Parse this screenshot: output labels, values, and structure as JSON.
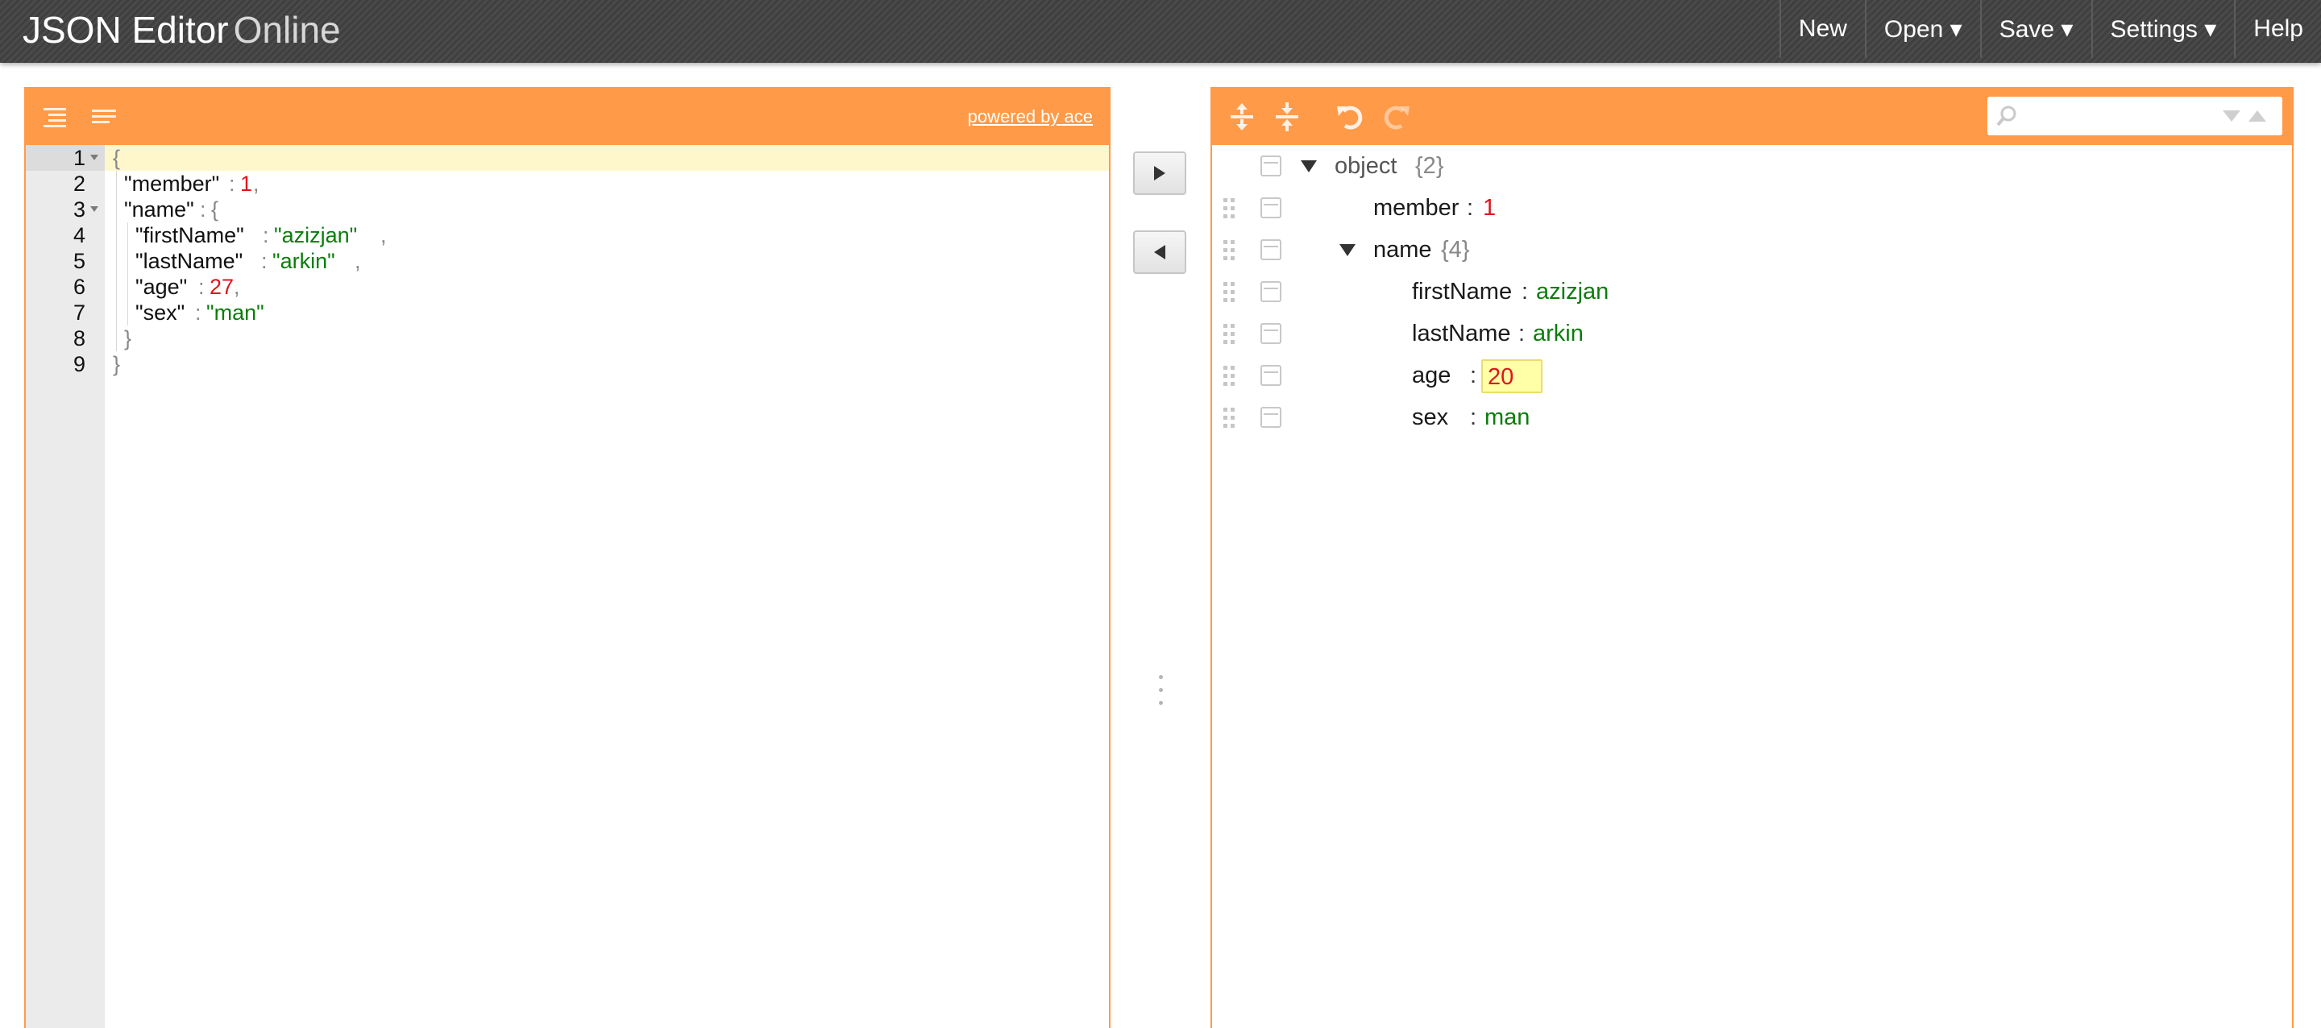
{
  "app": {
    "title_bold": "JSON Editor",
    "title_light": "Online"
  },
  "menu": {
    "new": "New",
    "open": "Open ▾",
    "save": "Save ▾",
    "settings": "Settings ▾",
    "help": "Help"
  },
  "code_editor": {
    "powered_by": "powered by ace",
    "toolbar": [
      "format-icon",
      "compact-icon"
    ],
    "line_numbers": [
      "1",
      "2",
      "3",
      "4",
      "5",
      "6",
      "7",
      "8",
      "9"
    ]
  },
  "tree_editor": {
    "toolbar": [
      "expand-all-icon",
      "collapse-all-icon",
      "undo-icon",
      "redo-icon"
    ],
    "search_placeholder": "",
    "root": {
      "label": "object",
      "count": "{2}"
    },
    "member": {
      "key": "member",
      "value": "1"
    },
    "name": {
      "key": "name",
      "count": "{4}"
    },
    "firstName": {
      "key": "firstName",
      "value": "azizjan"
    },
    "lastName": {
      "key": "lastName",
      "value": "arkin"
    },
    "age": {
      "key": "age",
      "value": "20"
    },
    "sex": {
      "key": "sex",
      "value": "man"
    },
    "separator": ":"
  },
  "code": {
    "l1": "{",
    "l2_key": "\"member\"",
    "l2_val": "1",
    "l3_key": "\"name\"",
    "l3_brace": "{",
    "l4_key": "\"firstName\"",
    "l4_val": "\"azizjan\"",
    "l5_key": "\"lastName\"",
    "l5_val": "\"arkin\"",
    "l6_key": "\"age\"",
    "l6_val": "27",
    "l7_key": "\"sex\"",
    "l7_val": "\"man\"",
    "l8": "}",
    "l9": "}"
  },
  "colors": {
    "accent": "#ff9a48",
    "string": "#0a7d0a",
    "number": "#e0141e",
    "header": "#444444"
  }
}
